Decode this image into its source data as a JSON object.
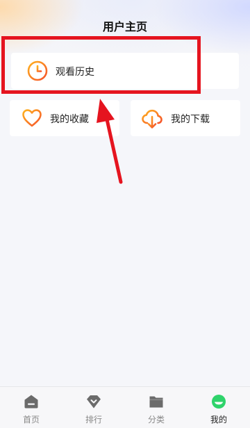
{
  "header": {
    "title": "用户主页"
  },
  "cards": {
    "history": {
      "label": "观看历史",
      "icon": "clock-icon"
    },
    "favorites": {
      "label": "我的收藏",
      "icon": "heart-icon"
    },
    "downloads": {
      "label": "我的下载",
      "icon": "cloud-download-icon"
    }
  },
  "colors": {
    "accent_start": "#ffb320",
    "accent_end": "#f5512a",
    "annotation_red": "#e5141f",
    "nav_active": "#2fd36b",
    "nav_inactive": "#6b6b6b"
  },
  "bottom_nav": {
    "items": [
      {
        "label": "首页",
        "icon": "home-icon",
        "active": false
      },
      {
        "label": "排行",
        "icon": "ranking-icon",
        "active": false
      },
      {
        "label": "分类",
        "icon": "folder-icon",
        "active": false
      },
      {
        "label": "我的",
        "icon": "profile-face-icon",
        "active": true
      }
    ]
  }
}
